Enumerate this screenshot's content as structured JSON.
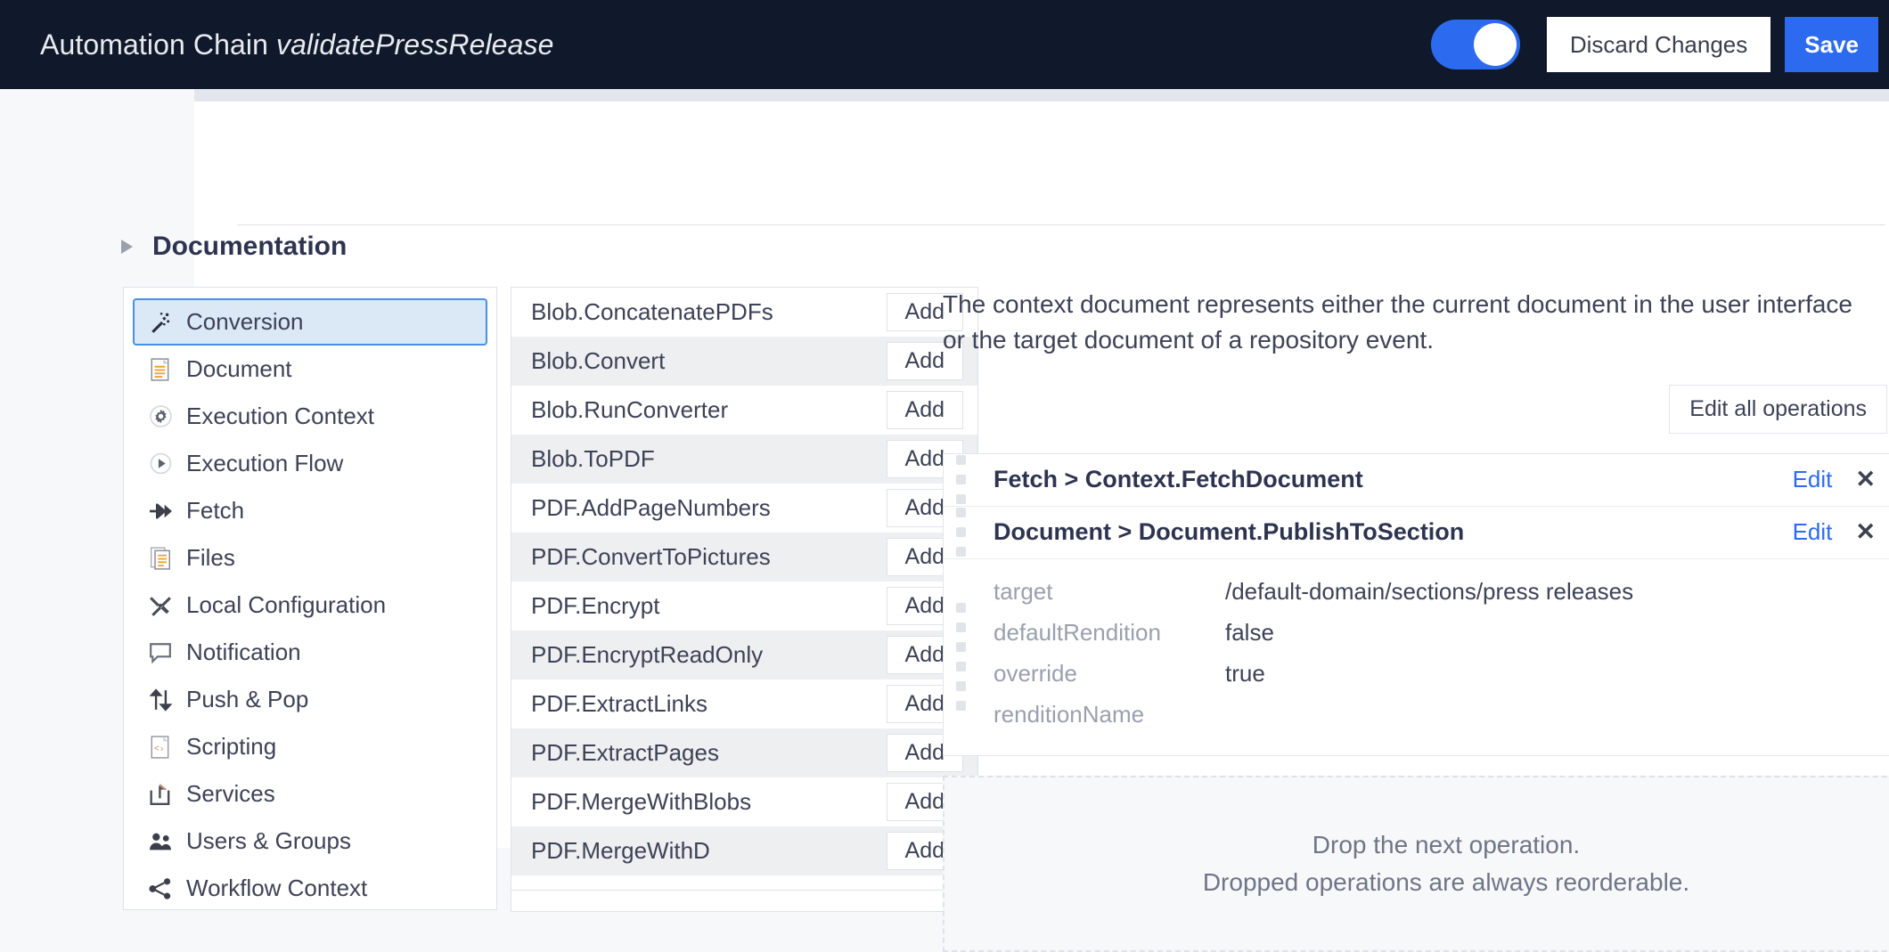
{
  "header": {
    "title_prefix": "Automation Chain ",
    "title_name": "validatePressRelease",
    "toggle_state": "on",
    "discard_label": "Discard Changes",
    "save_label": "Save",
    "background_color": "#10192b",
    "accent_color": "#2c6bf0"
  },
  "documentation": {
    "section_title": "Documentation",
    "expander": "collapsed"
  },
  "categories": [
    {
      "label": "Conversion",
      "icon": "magic-wand-icon",
      "selected": true
    },
    {
      "label": "Document",
      "icon": "document-icon",
      "selected": false
    },
    {
      "label": "Execution Context",
      "icon": "gear-icon",
      "selected": false
    },
    {
      "label": "Execution Flow",
      "icon": "play-circle-icon",
      "selected": false
    },
    {
      "label": "Fetch",
      "icon": "arrows-right-icon",
      "selected": false
    },
    {
      "label": "Files",
      "icon": "files-icon",
      "selected": false
    },
    {
      "label": "Local Configuration",
      "icon": "tools-icon",
      "selected": false
    },
    {
      "label": "Notification",
      "icon": "speech-bubble-icon",
      "selected": false
    },
    {
      "label": "Push & Pop",
      "icon": "push-pop-arrows-icon",
      "selected": false
    },
    {
      "label": "Scripting",
      "icon": "code-file-icon",
      "selected": false
    },
    {
      "label": "Services",
      "icon": "share-export-icon",
      "selected": false
    },
    {
      "label": "Users & Groups",
      "icon": "users-icon",
      "selected": false
    },
    {
      "label": "Workflow Context",
      "icon": "network-share-icon",
      "selected": false
    }
  ],
  "operations": {
    "add_label": "Add",
    "items": [
      {
        "name": "Blob.ConcatenatePDFs"
      },
      {
        "name": "Blob.Convert"
      },
      {
        "name": "Blob.RunConverter"
      },
      {
        "name": "Blob.ToPDF"
      },
      {
        "name": "PDF.AddPageNumbers"
      },
      {
        "name": "PDF.ConvertToPictures"
      },
      {
        "name": "PDF.Encrypt"
      },
      {
        "name": "PDF.EncryptReadOnly"
      },
      {
        "name": "PDF.ExtractLinks"
      },
      {
        "name": "PDF.ExtractPages"
      },
      {
        "name": "PDF.MergeWithBlobs"
      },
      {
        "name": "PDF.MergeWithD"
      }
    ]
  },
  "context": {
    "description": "The context document represents either the current document in the user interface or the target document of a repository event.",
    "edit_all_label": "Edit all operations"
  },
  "chain": {
    "edit_label": "Edit",
    "close_label": "✕",
    "help_label": "?",
    "steps": [
      {
        "title": "Fetch > Context.FetchDocument",
        "params": []
      },
      {
        "title": "Document > Document.PublishToSection",
        "params": [
          {
            "key": "target",
            "value": "/default-domain/sections/press releases"
          },
          {
            "key": "defaultRendition",
            "value": "false"
          },
          {
            "key": "override",
            "value": "true"
          },
          {
            "key": "renditionName",
            "value": ""
          }
        ]
      }
    ]
  },
  "dropzone": {
    "line1": "Drop the next operation.",
    "line2": "Dropped operations are always reorderable."
  }
}
